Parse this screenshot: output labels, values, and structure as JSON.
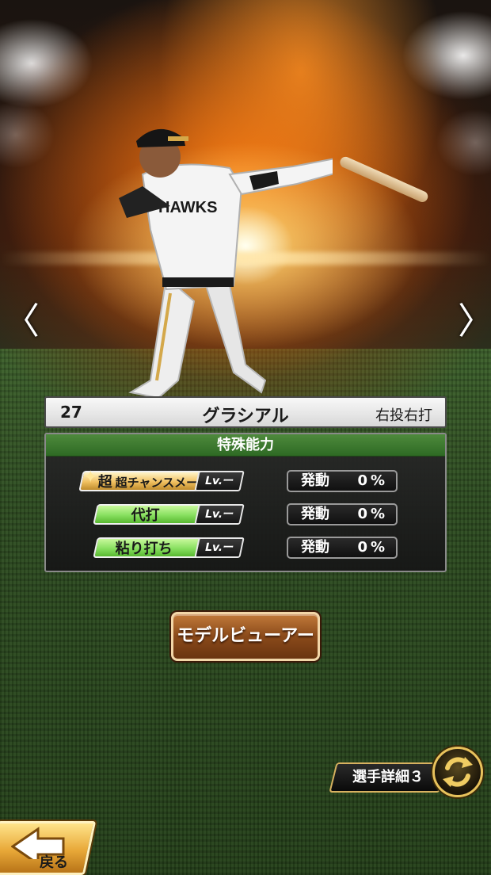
{
  "player": {
    "number": "27",
    "name": "グラシアル",
    "handedness": "右投右打"
  },
  "navigation": {
    "prev_glyph": "〈",
    "next_glyph": "〉"
  },
  "abilities": {
    "header": "特殊能力",
    "items": [
      {
        "badge_prefix": "超",
        "name": "超チャンスメーカー",
        "level": "Lv.ー",
        "activation_label": "発動",
        "activation_value": "0%",
        "tier": "gold"
      },
      {
        "name": "代打",
        "level": "Lv.ー",
        "activation_label": "発動",
        "activation_value": "0%",
        "tier": "green"
      },
      {
        "name": "粘り打ち",
        "level": "Lv.ー",
        "activation_label": "発動",
        "activation_value": "0%",
        "tier": "green"
      }
    ]
  },
  "buttons": {
    "model_viewer": "モデルビューアー",
    "player_detail": "選手詳細３",
    "back": "戻る"
  },
  "colors": {
    "ability_header": "#3e7a30",
    "gold_badge": "#f0c060",
    "green_badge": "#88e060",
    "model_button": "#8a4a1a"
  },
  "icons": {
    "cycle": "cycle-arrows-icon",
    "back": "back-arrow-icon",
    "star": "sparkle-star-icon"
  }
}
